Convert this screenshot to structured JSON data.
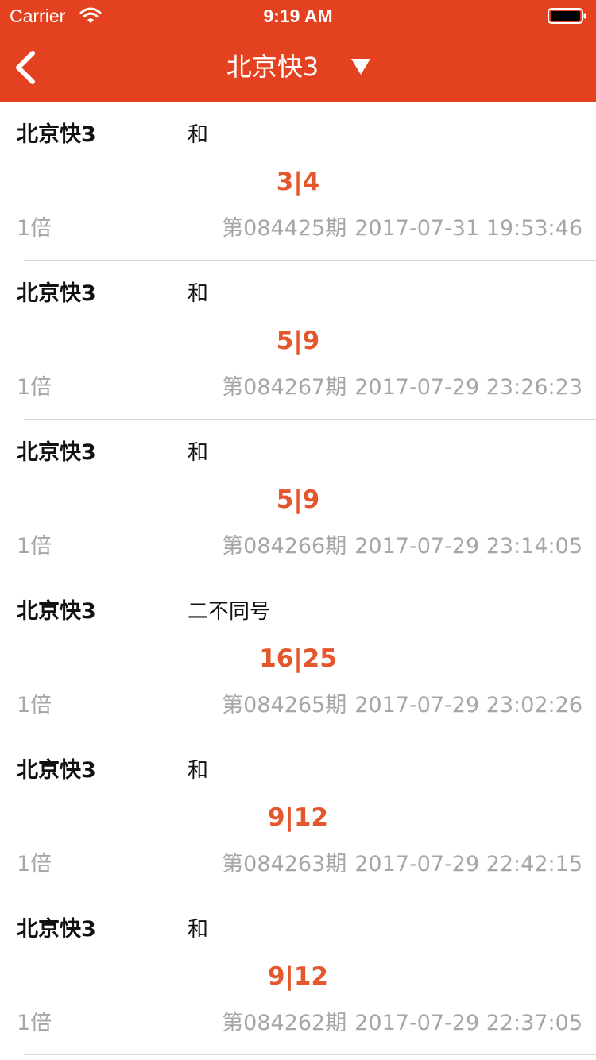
{
  "status_bar": {
    "carrier": "Carrier",
    "time": "9:19 AM"
  },
  "nav": {
    "title": "北京快3",
    "background_color": "#e3411f",
    "back_icon": "chevron-left-icon",
    "dropdown_icon": "triangle-down-icon"
  },
  "colors": {
    "accent": "#e4562c",
    "secondary_text": "#a6a6a6",
    "divider": "#d9d9d9"
  },
  "records": [
    {
      "lottery": "北京快3",
      "play": "和",
      "numbers": "3|4",
      "multiple": "1倍",
      "issue": "第084425期",
      "datetime": "2017-07-31 19:53:46"
    },
    {
      "lottery": "北京快3",
      "play": "和",
      "numbers": "5|9",
      "multiple": "1倍",
      "issue": "第084267期",
      "datetime": "2017-07-29 23:26:23"
    },
    {
      "lottery": "北京快3",
      "play": "和",
      "numbers": "5|9",
      "multiple": "1倍",
      "issue": "第084266期",
      "datetime": "2017-07-29 23:14:05"
    },
    {
      "lottery": "北京快3",
      "play": "二不同号",
      "numbers": "16|25",
      "multiple": "1倍",
      "issue": "第084265期",
      "datetime": "2017-07-29 23:02:26"
    },
    {
      "lottery": "北京快3",
      "play": "和",
      "numbers": "9|12",
      "multiple": "1倍",
      "issue": "第084263期",
      "datetime": "2017-07-29 22:42:15"
    },
    {
      "lottery": "北京快3",
      "play": "和",
      "numbers": "9|12",
      "multiple": "1倍",
      "issue": "第084262期",
      "datetime": "2017-07-29 22:37:05"
    }
  ]
}
